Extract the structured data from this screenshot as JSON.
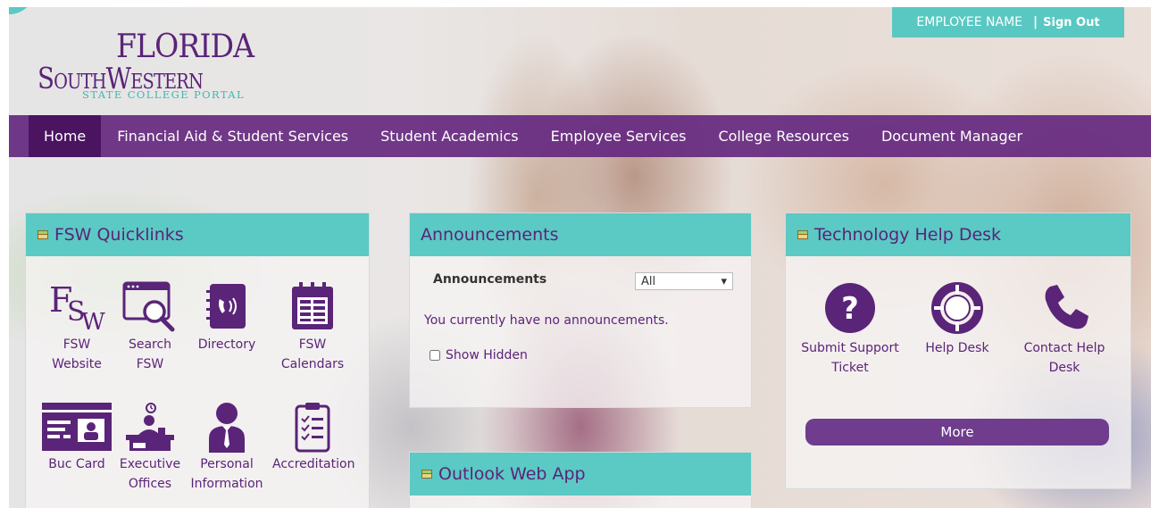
{
  "header": {
    "logo_line1": "FLORIDA",
    "logo_line2": "SouthWestern",
    "logo_line3": "STATE COLLEGE PORTAL",
    "user_name": "EMPLOYEE NAME",
    "separator": "|",
    "sign_out": "Sign Out"
  },
  "nav": {
    "items": [
      {
        "label": "Home",
        "active": true
      },
      {
        "label": "Financial Aid & Student Services"
      },
      {
        "label": "Student Academics"
      },
      {
        "label": "Employee Services"
      },
      {
        "label": "College Resources"
      },
      {
        "label": "Document Manager"
      }
    ]
  },
  "quicklinks": {
    "title": "FSW Quicklinks",
    "items": [
      {
        "label_line1": "FSW",
        "label_line2": "Website",
        "icon": "fsw-logo-icon"
      },
      {
        "label_line1": "Search",
        "label_line2": "FSW",
        "icon": "search-window-icon"
      },
      {
        "label_line1": "Directory",
        "label_line2": "",
        "icon": "phone-book-icon"
      },
      {
        "label_line1": "FSW",
        "label_line2": "Calendars",
        "icon": "calendar-icon"
      },
      {
        "label_line1": "Buc Card",
        "label_line2": "",
        "icon": "id-card-icon"
      },
      {
        "label_line1": "Executive",
        "label_line2": "Offices",
        "icon": "executive-desk-icon"
      },
      {
        "label_line1": "Personal",
        "label_line2": "Information",
        "icon": "person-icon"
      },
      {
        "label_line1": "Accreditation",
        "label_line2": "",
        "icon": "clipboard-icon"
      }
    ]
  },
  "announcements": {
    "title": "Announcements",
    "label": "Announcements",
    "filter_value": "All",
    "empty_message": "You currently have no announcements.",
    "show_hidden": "Show Hidden"
  },
  "outlook": {
    "title": "Outlook Web App"
  },
  "helpdesk": {
    "title": "Technology Help Desk",
    "items": [
      {
        "label_line1": "Submit Support",
        "label_line2": "Ticket",
        "icon": "question-icon"
      },
      {
        "label_line1": "Help Desk",
        "label_line2": "",
        "icon": "lifebuoy-icon"
      },
      {
        "label_line1": "Contact Help",
        "label_line2": "Desk",
        "icon": "phone-icon"
      }
    ],
    "more_label": "More"
  },
  "colors": {
    "purple": "#5a2478",
    "teal": "#5bc9c4",
    "nav_bg": "#662a80"
  }
}
